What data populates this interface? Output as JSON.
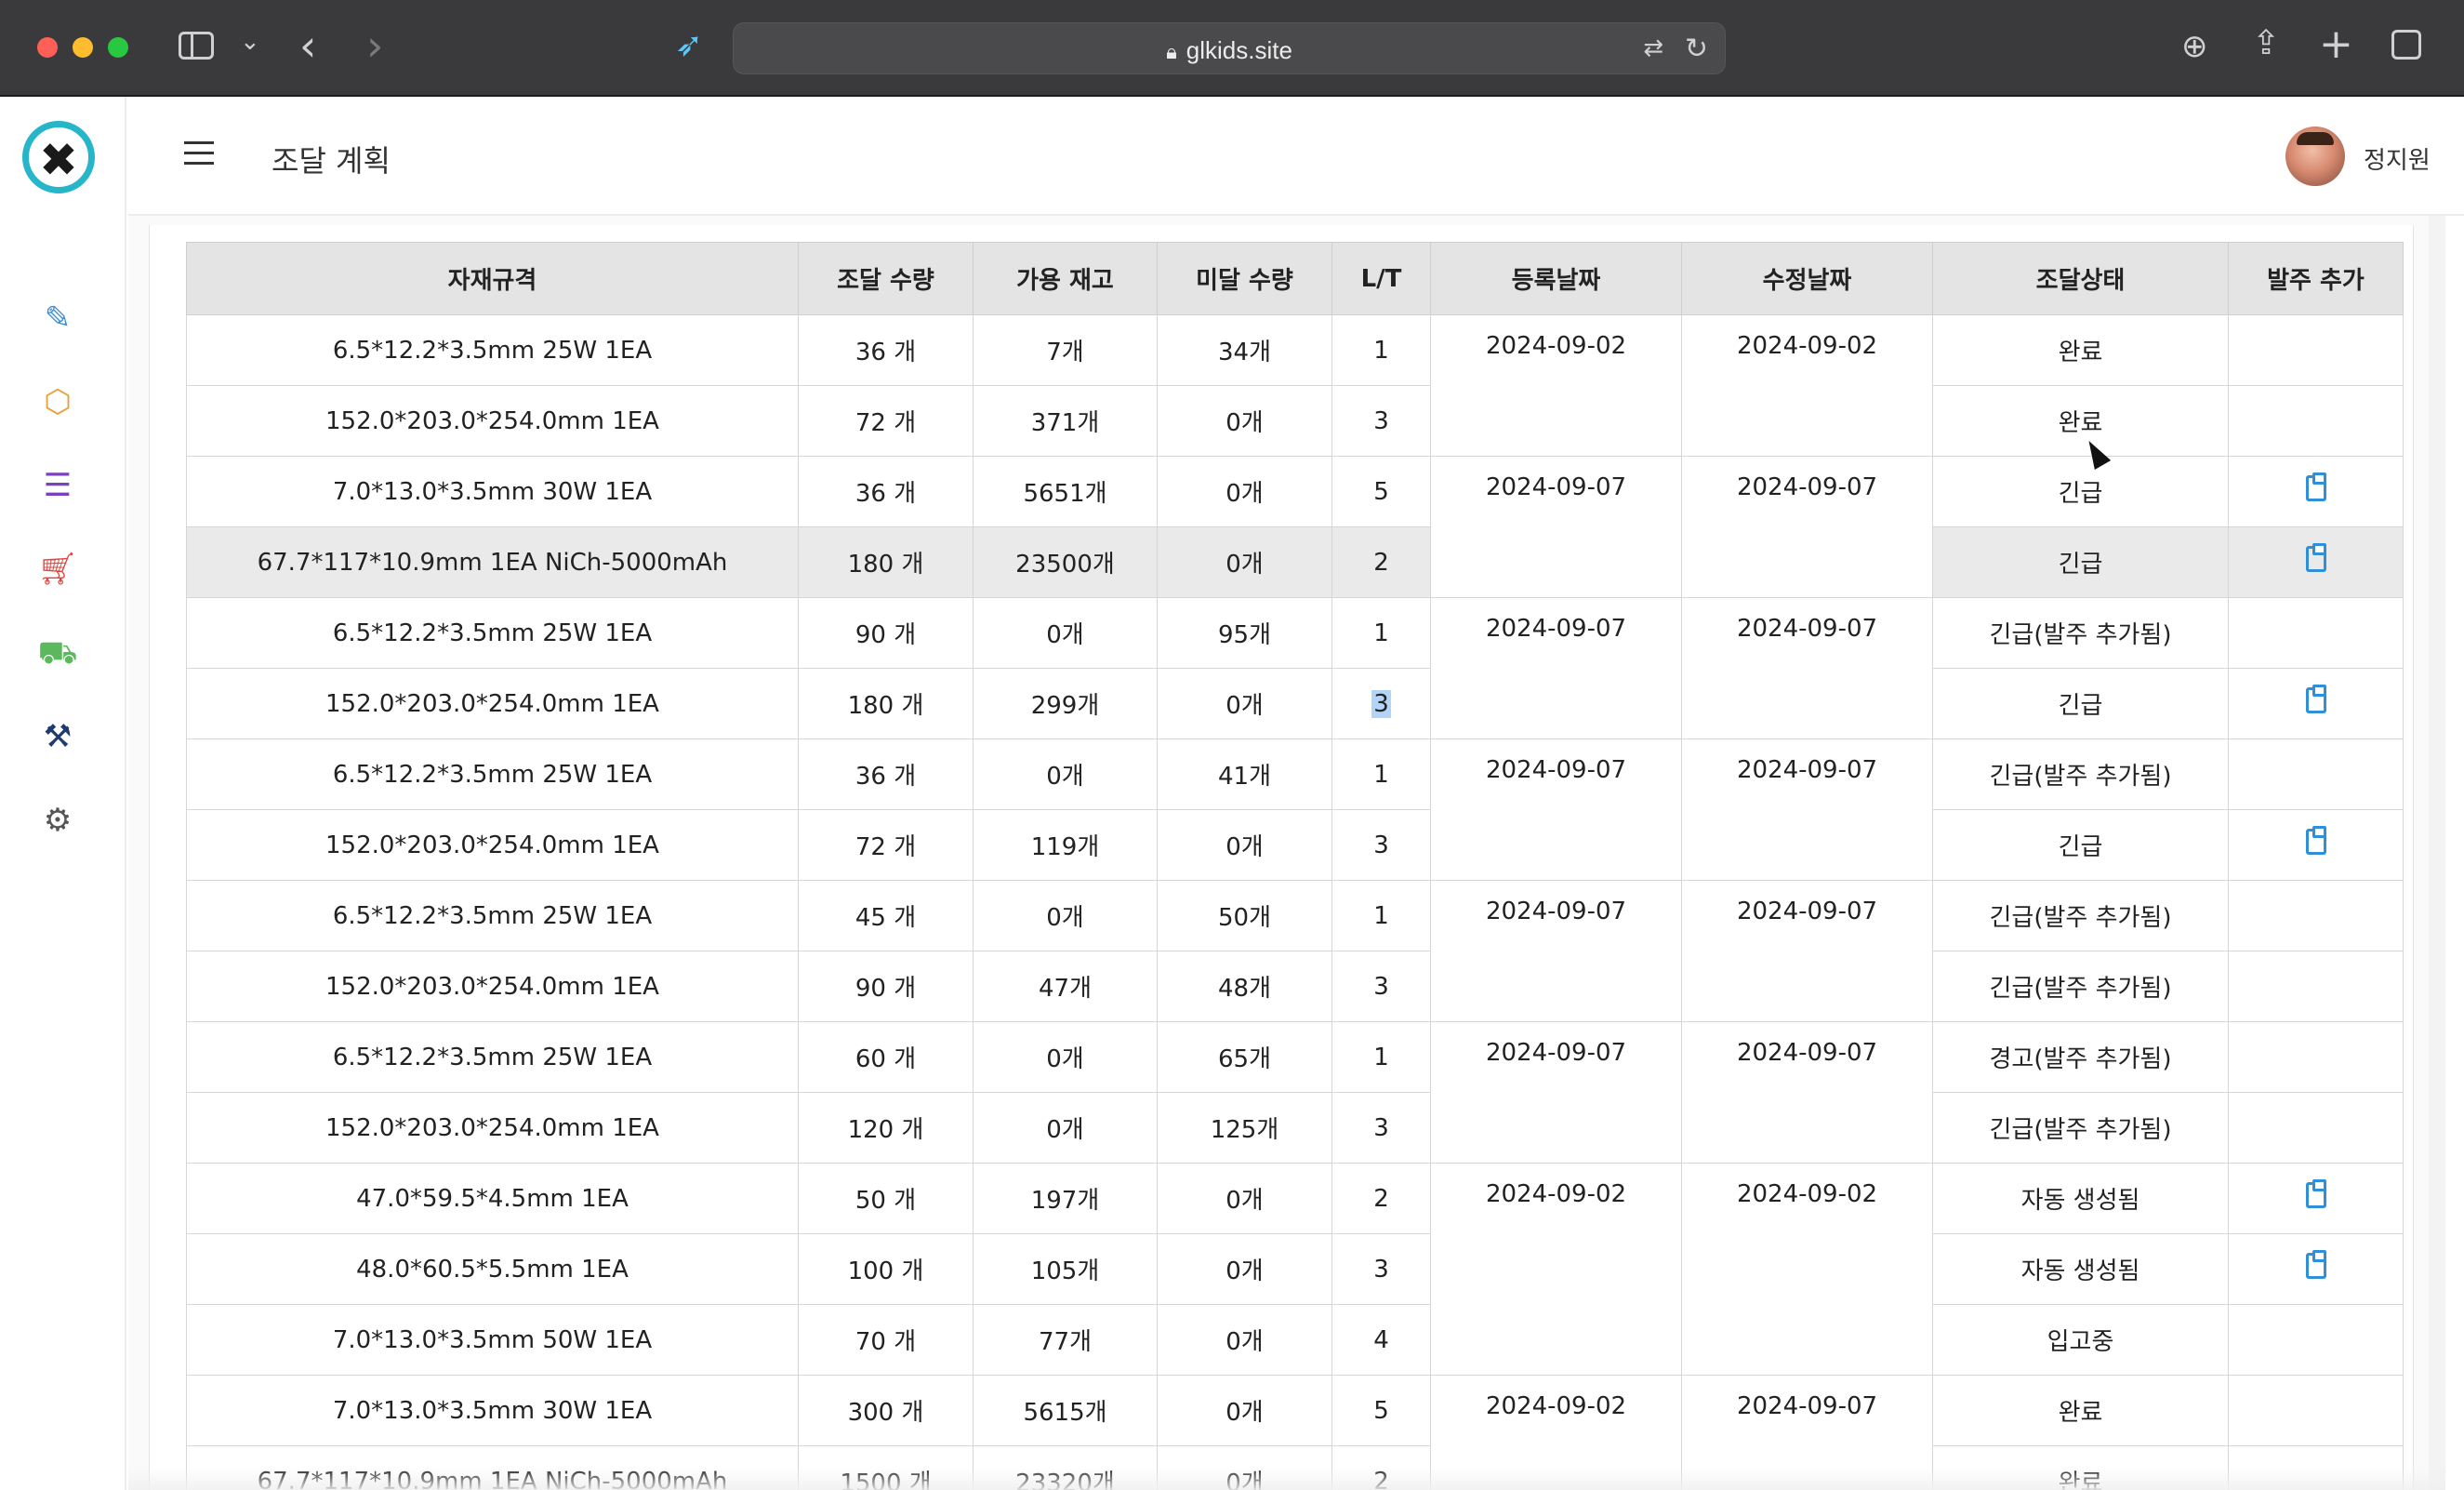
{
  "browser": {
    "url": "glkids.site"
  },
  "header": {
    "title": "조달 계획",
    "user_name": "정지원"
  },
  "sidebar": {
    "icons": [
      "edit-icon",
      "box-icon",
      "list-icon",
      "cart-icon",
      "truck-icon",
      "hammer-icon",
      "gear-icon"
    ]
  },
  "table": {
    "columns": [
      "자재규격",
      "조달 수량",
      "가용 재고",
      "미달 수량",
      "L/T",
      "등록날짜",
      "수정날짜",
      "조달상태",
      "발주 추가"
    ],
    "rows": [
      {
        "spec": "6.5*12.2*3.5mm 25W 1EA",
        "qty": "36 개",
        "stock": "7개",
        "short": "34개",
        "lt": "1",
        "status": "완료",
        "order": false
      },
      {
        "spec": "152.0*203.0*254.0mm 1EA",
        "qty": "72 개",
        "stock": "371개",
        "short": "0개",
        "lt": "3",
        "status": "완료",
        "order": false
      },
      {
        "spec": "7.0*13.0*3.5mm 30W 1EA",
        "qty": "36 개",
        "stock": "5651개",
        "short": "0개",
        "lt": "5",
        "status": "긴급",
        "order": true
      },
      {
        "spec": "67.7*117*10.9mm 1EA NiCh-5000mAh",
        "qty": "180 개",
        "stock": "23500개",
        "short": "0개",
        "lt": "2",
        "status": "긴급",
        "order": true
      },
      {
        "spec": "6.5*12.2*3.5mm 25W 1EA",
        "qty": "90 개",
        "stock": "0개",
        "short": "95개",
        "lt": "1",
        "status": "긴급(발주 추가됨)",
        "order": false
      },
      {
        "spec": "152.0*203.0*254.0mm 1EA",
        "qty": "180 개",
        "stock": "299개",
        "short": "0개",
        "lt": "3",
        "status": "긴급",
        "order": true
      },
      {
        "spec": "6.5*12.2*3.5mm 25W 1EA",
        "qty": "36 개",
        "stock": "0개",
        "short": "41개",
        "lt": "1",
        "status": "긴급(발주 추가됨)",
        "order": false
      },
      {
        "spec": "152.0*203.0*254.0mm 1EA",
        "qty": "72 개",
        "stock": "119개",
        "short": "0개",
        "lt": "3",
        "status": "긴급",
        "order": true
      },
      {
        "spec": "6.5*12.2*3.5mm 25W 1EA",
        "qty": "45 개",
        "stock": "0개",
        "short": "50개",
        "lt": "1",
        "status": "긴급(발주 추가됨)",
        "order": false
      },
      {
        "spec": "152.0*203.0*254.0mm 1EA",
        "qty": "90 개",
        "stock": "47개",
        "short": "48개",
        "lt": "3",
        "status": "긴급(발주 추가됨)",
        "order": false
      },
      {
        "spec": "6.5*12.2*3.5mm 25W 1EA",
        "qty": "60 개",
        "stock": "0개",
        "short": "65개",
        "lt": "1",
        "status": "경고(발주 추가됨)",
        "order": false
      },
      {
        "spec": "152.0*203.0*254.0mm 1EA",
        "qty": "120 개",
        "stock": "0개",
        "short": "125개",
        "lt": "3",
        "status": "긴급(발주 추가됨)",
        "order": false
      },
      {
        "spec": "47.0*59.5*4.5mm 1EA",
        "qty": "50 개",
        "stock": "197개",
        "short": "0개",
        "lt": "2",
        "status": "자동 생성됨",
        "order": true
      },
      {
        "spec": "48.0*60.5*5.5mm 1EA",
        "qty": "100 개",
        "stock": "105개",
        "short": "0개",
        "lt": "3",
        "status": "자동 생성됨",
        "order": true
      },
      {
        "spec": "7.0*13.0*3.5mm 50W 1EA",
        "qty": "70 개",
        "stock": "77개",
        "short": "0개",
        "lt": "4",
        "status": "입고중",
        "order": false
      },
      {
        "spec": "7.0*13.0*3.5mm 30W 1EA",
        "qty": "300 개",
        "stock": "5615개",
        "short": "0개",
        "lt": "5",
        "status": "완료",
        "order": false
      },
      {
        "spec": "67.7*117*10.9mm 1EA NiCh-5000mAh",
        "qty": "1500 개",
        "stock": "23320개",
        "short": "0개",
        "lt": "2",
        "status": "완료",
        "order": false
      }
    ],
    "date_groups": [
      {
        "start": 0,
        "span": 2,
        "created": "2024-09-02",
        "modified": "2024-09-02"
      },
      {
        "start": 2,
        "span": 2,
        "created": "2024-09-07",
        "modified": "2024-09-07"
      },
      {
        "start": 4,
        "span": 2,
        "created": "2024-09-07",
        "modified": "2024-09-07"
      },
      {
        "start": 6,
        "span": 2,
        "created": "2024-09-07",
        "modified": "2024-09-07"
      },
      {
        "start": 8,
        "span": 2,
        "created": "2024-09-07",
        "modified": "2024-09-07"
      },
      {
        "start": 10,
        "span": 2,
        "created": "2024-09-07",
        "modified": "2024-09-07"
      },
      {
        "start": 12,
        "span": 3,
        "created": "2024-09-02",
        "modified": "2024-09-02"
      },
      {
        "start": 15,
        "span": 2,
        "created": "2024-09-02",
        "modified": "2024-09-07"
      }
    ],
    "highlighted_row": 3,
    "selected_lt_row": 5
  }
}
